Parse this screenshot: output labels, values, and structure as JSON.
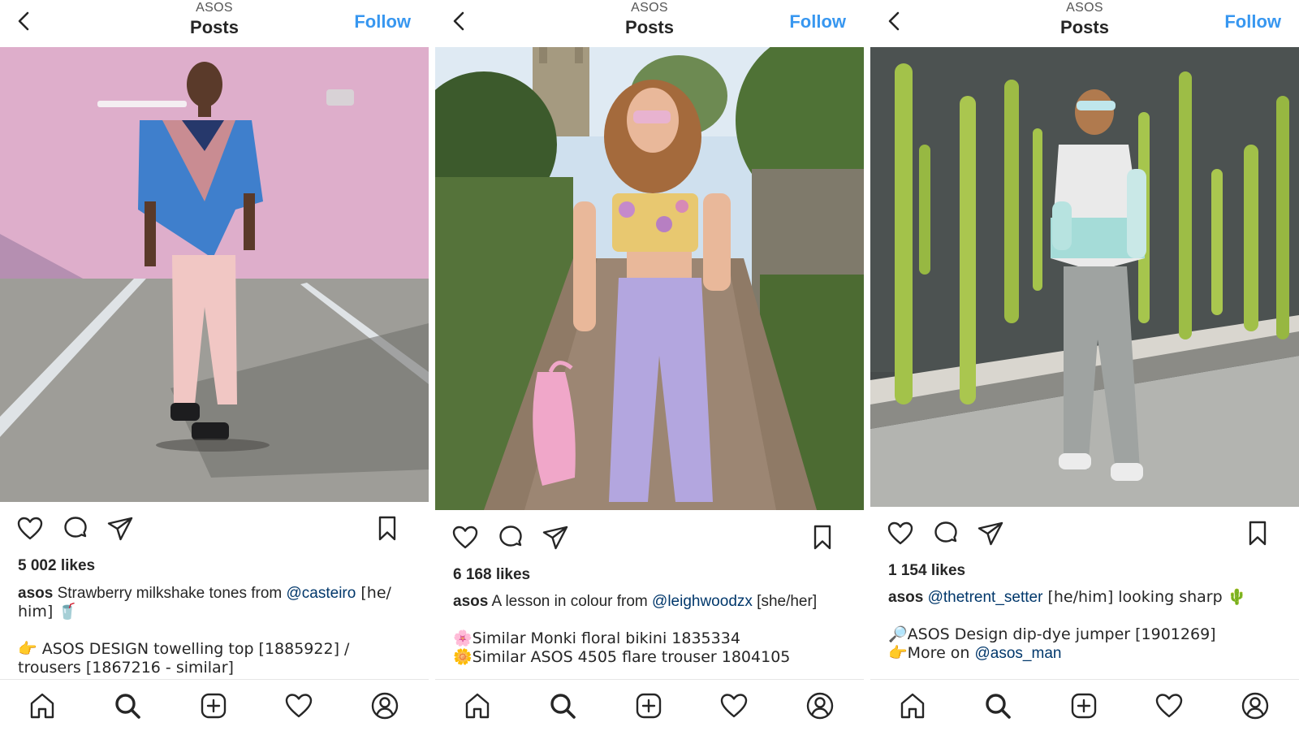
{
  "panels": [
    {
      "header": {
        "account": "ASOS",
        "title": "Posts",
        "follow_label": "Follow"
      },
      "likes": "5 002 likes",
      "caption": {
        "username": "asos",
        "text_before": "Strawberry milkshake tones from ",
        "mention": "@casteiro",
        "text_after": " [he/ him] 🥤",
        "line2": "👉 ASOS DESIGN towelling top [1885922] / trousers [1867216 - similar]",
        "line3": ""
      }
    },
    {
      "header": {
        "account": "ASOS",
        "title": "Posts",
        "follow_label": "Follow"
      },
      "likes": "6 168 likes",
      "caption": {
        "username": "asos",
        "text_before": "A lesson in colour from ",
        "mention": "@leighwoodzx",
        "text_after": " [she/her]",
        "line2": "🌸Similar Monki floral bikini 1835334",
        "line3": "🌼Similar ASOS 4505 flare trouser 1804105"
      }
    },
    {
      "header": {
        "account": "ASOS",
        "title": "Posts",
        "follow_label": "Follow"
      },
      "likes": "1 154 likes",
      "caption": {
        "username": "asos",
        "text_before": "",
        "mention": "@thetrent_setter",
        "text_after": " [he/him] looking sharp 🌵",
        "line2": "🔎ASOS Design dip-dye jumper [1901269]",
        "line3_prefix": "👉More on ",
        "line3_mention": "@asos_man"
      }
    }
  ],
  "icons": {
    "header": [
      "back-icon"
    ],
    "actions": [
      "heart-icon",
      "comment-icon",
      "share-icon",
      "bookmark-icon"
    ],
    "bottom_nav": [
      "home-icon",
      "search-icon",
      "add-post-icon",
      "activity-heart-icon",
      "profile-icon"
    ]
  },
  "colors": {
    "follow": "#3897f0",
    "mention": "#00376b",
    "text": "#262626"
  }
}
